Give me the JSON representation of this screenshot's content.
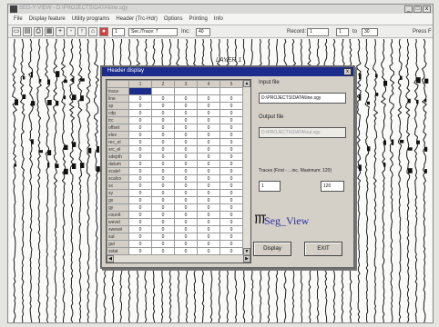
{
  "window": {
    "title": "SEG-Y VIEW - D:\\PROJECTS\\DATA\\line.sgy",
    "controls": [
      "_",
      "□",
      "x"
    ]
  },
  "menubar": {
    "items": [
      "File",
      "Display feature",
      "Utility programs",
      "Header (Trc-Hdr)",
      "Options",
      "Printing",
      "Info"
    ]
  },
  "toolbar": {
    "buttons": [
      {
        "icon": "open-icon",
        "glyph": "▭"
      },
      {
        "icon": "save-icon",
        "glyph": "▤"
      },
      {
        "icon": "print-icon",
        "glyph": "⎙"
      },
      {
        "icon": "chart-icon",
        "glyph": "▦"
      },
      {
        "icon": "zoom-in-icon",
        "glyph": "+"
      },
      {
        "icon": "zoom-out-icon",
        "glyph": "-"
      },
      {
        "icon": "arrow-icon",
        "glyph": "↑"
      },
      {
        "icon": "home-icon",
        "glyph": "⌂"
      },
      {
        "icon": "record-icon",
        "glyph": "●"
      }
    ],
    "trace_value": "1",
    "time_select": "Sec./Trace: 7",
    "from_label": "Inc:",
    "from_value": "40",
    "record_label": "Record:",
    "record_from": "1",
    "record_to_label": "to",
    "record_to": "30",
    "press_label": "Press F"
  },
  "seismic": {
    "annotation": "LAYER 1"
  },
  "dialog": {
    "title": "Header display",
    "close_glyph": "x",
    "grid": {
      "columns": [
        "",
        "1",
        "2",
        "3",
        "4",
        "5"
      ],
      "rows": [
        {
          "label": "trace",
          "values": [
            "",
            "",
            "",
            "",
            ""
          ]
        },
        {
          "label": "line",
          "values": [
            "0",
            "0",
            "0",
            "0",
            "0"
          ]
        },
        {
          "label": "sp",
          "values": [
            "0",
            "0",
            "0",
            "0",
            "0"
          ]
        },
        {
          "label": "cdp",
          "values": [
            "0",
            "0",
            "0",
            "0",
            "0"
          ]
        },
        {
          "label": "trc",
          "values": [
            "0",
            "0",
            "0",
            "0",
            "0"
          ]
        },
        {
          "label": "offset",
          "values": [
            "0",
            "0",
            "0",
            "0",
            "0"
          ]
        },
        {
          "label": "elev",
          "values": [
            "0",
            "0",
            "0",
            "0",
            "0"
          ]
        },
        {
          "label": "rec_el",
          "values": [
            "0",
            "0",
            "0",
            "0",
            "0"
          ]
        },
        {
          "label": "src_el",
          "values": [
            "0",
            "0",
            "0",
            "0",
            "0"
          ]
        },
        {
          "label": "sdepth",
          "values": [
            "0",
            "0",
            "0",
            "0",
            "0"
          ]
        },
        {
          "label": "datum",
          "values": [
            "0",
            "0",
            "0",
            "0",
            "0"
          ]
        },
        {
          "label": "scalel",
          "values": [
            "0",
            "0",
            "0",
            "0",
            "0"
          ]
        },
        {
          "label": "scalco",
          "values": [
            "0",
            "0",
            "0",
            "0",
            "0"
          ]
        },
        {
          "label": "sx",
          "values": [
            "0",
            "0",
            "0",
            "0",
            "0"
          ]
        },
        {
          "label": "sy",
          "values": [
            "0",
            "0",
            "0",
            "0",
            "0"
          ]
        },
        {
          "label": "gx",
          "values": [
            "0",
            "0",
            "0",
            "0",
            "0"
          ]
        },
        {
          "label": "gy",
          "values": [
            "0",
            "0",
            "0",
            "0",
            "0"
          ]
        },
        {
          "label": "counit",
          "values": [
            "0",
            "0",
            "0",
            "0",
            "0"
          ]
        },
        {
          "label": "wevel",
          "values": [
            "0",
            "0",
            "0",
            "0",
            "0"
          ]
        },
        {
          "label": "swevel",
          "values": [
            "0",
            "0",
            "0",
            "0",
            "0"
          ]
        },
        {
          "label": "sut",
          "values": [
            "0",
            "0",
            "0",
            "0",
            "0"
          ]
        },
        {
          "label": "gut",
          "values": [
            "0",
            "0",
            "0",
            "0",
            "0"
          ]
        },
        {
          "label": "sstat",
          "values": [
            "0",
            "0",
            "0",
            "0",
            "0"
          ]
        },
        {
          "label": "gstat",
          "values": [
            "0",
            "0",
            "0",
            "0",
            "0"
          ]
        },
        {
          "label": "tstat",
          "values": [
            "0",
            "0",
            "0",
            "0",
            "0"
          ]
        }
      ]
    },
    "input_file_label": "Input file",
    "input_file_value": "D:\\PROJECTS\\DATA\\line.sgy",
    "output_file_label": "Output file",
    "output_file_value": "D:\\PROJECTS\\DATA\\out.sgy",
    "traces_label": "Traces (First - .. inc. Maximum: 120)",
    "traces_first": "1",
    "traces_max": "120",
    "logo_text": "Seg_View",
    "display_button": "Display",
    "exit_button": "EXIT"
  },
  "colors": {
    "dialog_title_bg": "#1c2c8c",
    "logo_text": "#2b2fa0",
    "selected_cell": "#1c2c8c"
  }
}
